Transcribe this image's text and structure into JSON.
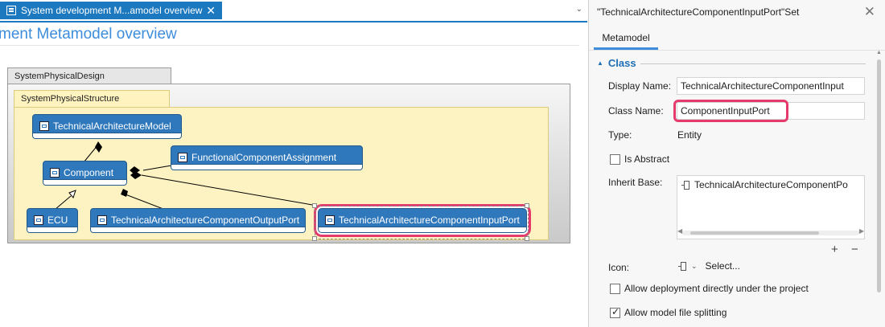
{
  "editor": {
    "tab_title": "System development M...amodel overview",
    "tab_close": "✕",
    "tab_menu": "⌄",
    "page_title": "ment Metamodel overview",
    "package_label": "SystemPhysicalDesign",
    "structure_label": "SystemPhysicalStructure",
    "nodes": {
      "technical_architecture_model": "TechnicalArchitectureModel",
      "component": "Component",
      "functional_component_assignment": "FunctionalComponentAssignment",
      "ecu": "ECU",
      "output_port": "TechnicalArchitectureComponentOutputPort",
      "input_port": "TechnicalArchitectureComponentInputPort"
    }
  },
  "panel": {
    "header": "\"TechnicalArchitectureComponentInputPort\"Set",
    "close": "✕",
    "tab": "Metamodel",
    "section": "Class",
    "display_name_label": "Display Name:",
    "display_name_value": "TechnicalArchitectureComponentInput",
    "class_name_label": "Class Name:",
    "class_name_value": "ComponentInputPort",
    "type_label": "Type:",
    "type_value": "Entity",
    "is_abstract_label": "Is Abstract",
    "inherit_base_label": "Inherit Base:",
    "inherit_base_item": "TechnicalArchitectureComponentPo",
    "add_button": "+",
    "remove_button": "−",
    "icon_label": "Icon:",
    "icon_select": "Select...",
    "allow_deployment_label": "Allow deployment directly under the project",
    "allow_splitting_label": "Allow model file splitting",
    "is_abstract_checked": false,
    "allow_deployment_checked": false,
    "allow_splitting_checked": true
  },
  "colors": {
    "accent": "#1c79c0",
    "node_fill": "#2f78bc",
    "highlight": "#e43b6c",
    "structure_fill": "#fdf3c2"
  }
}
